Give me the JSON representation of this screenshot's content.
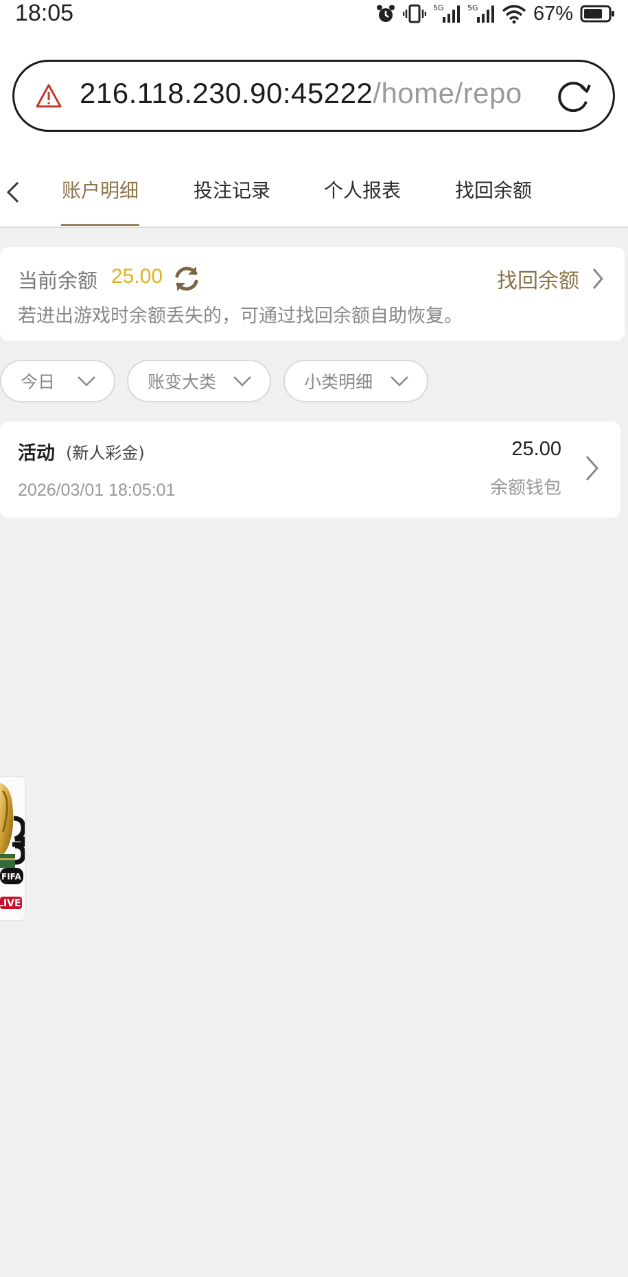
{
  "status_bar": {
    "time": "18:05",
    "battery": "67%"
  },
  "browser": {
    "url_host": "216.118.230.90:45222",
    "url_path": "/home/repo"
  },
  "tabs": [
    {
      "label": "账户明细",
      "active": true
    },
    {
      "label": "投注记录",
      "active": false
    },
    {
      "label": "个人报表",
      "active": false
    },
    {
      "label": "找回余额",
      "active": false
    }
  ],
  "balance": {
    "label": "当前余额",
    "value": "25.00",
    "recover_label": "找回余额",
    "hint": "若进出游戏时余额丢失的，可通过找回余额自助恢复。"
  },
  "filters": [
    {
      "label": "今日"
    },
    {
      "label": "账变大类"
    },
    {
      "label": "小类明细"
    }
  ],
  "records": [
    {
      "title": "活动",
      "subtitle": "(新人彩金)",
      "time": "2026/03/01 18:05:01",
      "amount": "25.00",
      "wallet": "余额钱包"
    }
  ],
  "floating_banner": {
    "badge": "LIVE",
    "brand": "FIFA"
  },
  "colors": {
    "accent": "#8b7348",
    "balance": "#e0b21c",
    "warning": "#c0392b",
    "background": "#f0f0f0"
  }
}
